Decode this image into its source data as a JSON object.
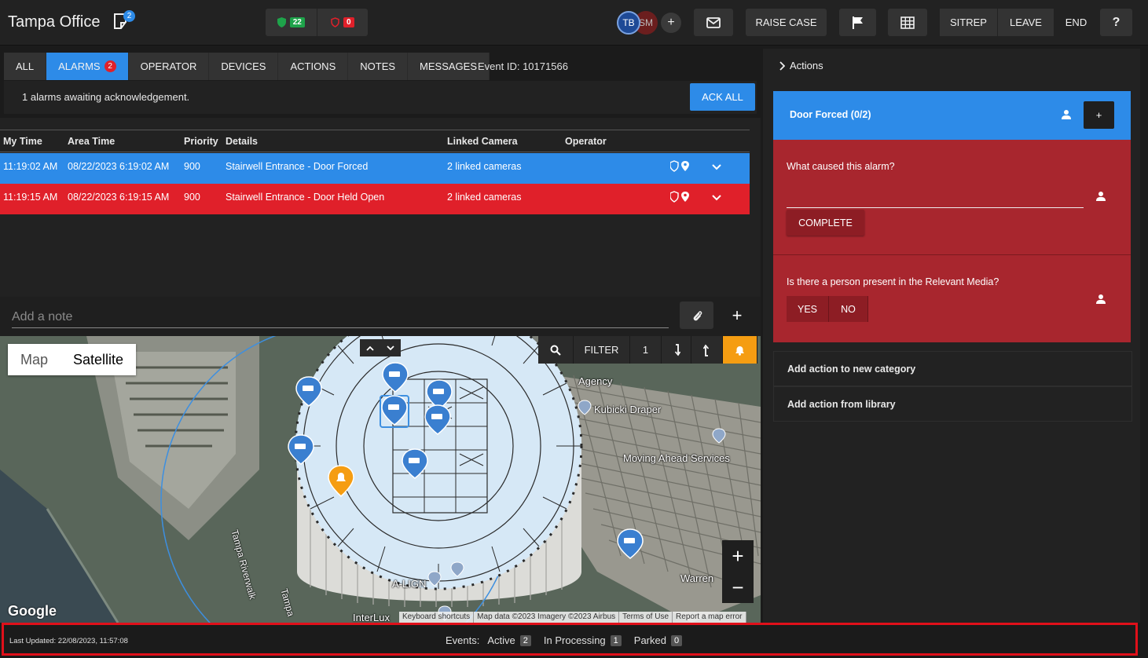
{
  "header": {
    "title": "Tampa Office",
    "notes_badge": "2",
    "status_green": "22",
    "status_red": "0",
    "avatars": [
      "TB",
      "SM"
    ],
    "add_user": "+",
    "raise_case": "RAISE CASE",
    "sitrep": "SITREP",
    "leave": "LEAVE",
    "end": "END",
    "help": "?"
  },
  "tabs": [
    {
      "label": "ALL"
    },
    {
      "label": "ALARMS",
      "badge": "2"
    },
    {
      "label": "OPERATOR"
    },
    {
      "label": "DEVICES"
    },
    {
      "label": "ACTIONS"
    },
    {
      "label": "NOTES"
    },
    {
      "label": "MESSAGES"
    }
  ],
  "event_id": "Event ID: 10171566",
  "ack": {
    "text": "1 alarms awaiting acknowledgement.",
    "button": "ACK ALL"
  },
  "table": {
    "columns": [
      "My Time",
      "Area Time",
      "Priority",
      "Details",
      "Linked Camera",
      "Operator"
    ],
    "rows": [
      {
        "my_time": "11:19:02 AM",
        "area_time": "08/22/2023 6:19:02 AM",
        "priority": "900",
        "details": "Stairwell Entrance - Door Forced",
        "camera": "2 linked cameras",
        "operator": ""
      },
      {
        "my_time": "11:19:15 AM",
        "area_time": "08/22/2023 6:19:15 AM",
        "priority": "900",
        "details": "Stairwell Entrance - Door Held Open",
        "camera": "2 linked cameras",
        "operator": ""
      }
    ]
  },
  "note": {
    "placeholder": "Add a note",
    "add": "+"
  },
  "map": {
    "type_map": "Map",
    "type_satellite": "Satellite",
    "filter": "FILTER",
    "filter_count": "1",
    "zoom_in": "+",
    "zoom_out": "−",
    "google": "Google",
    "attribution": [
      "Keyboard shortcuts",
      "Map data ©2023 Imagery ©2023 Airbus",
      "Terms of Use",
      "Report a map error"
    ],
    "labels": [
      "Agency",
      "Kubicki Draper",
      "Moving Ahead Services",
      "Tampa Riverwalk",
      "Tampa",
      "A-LIGN",
      "InterLux",
      "Warren"
    ]
  },
  "actions_panel": {
    "header": "Actions",
    "card_title": "Door Forced (0/2)",
    "card_add": "+",
    "q1": "What caused this alarm?",
    "q1_button": "COMPLETE",
    "q2": "Is there a person present in the Relevant Media?",
    "q2_yes": "YES",
    "q2_no": "NO",
    "add_category": "Add action to new category",
    "add_library": "Add action from library"
  },
  "footer": {
    "last_updated": "Last Updated: 22/08/2023, 11:57:08",
    "events_label": "Events:",
    "active_label": "Active",
    "active_count": "2",
    "processing_label": "In Processing",
    "processing_count": "1",
    "parked_label": "Parked",
    "parked_count": "0"
  },
  "colors": {
    "accent_blue": "#2d8be8",
    "alarm_red": "#e0202a",
    "action_red": "#a8262e",
    "alarm_orange": "#f59d12"
  }
}
